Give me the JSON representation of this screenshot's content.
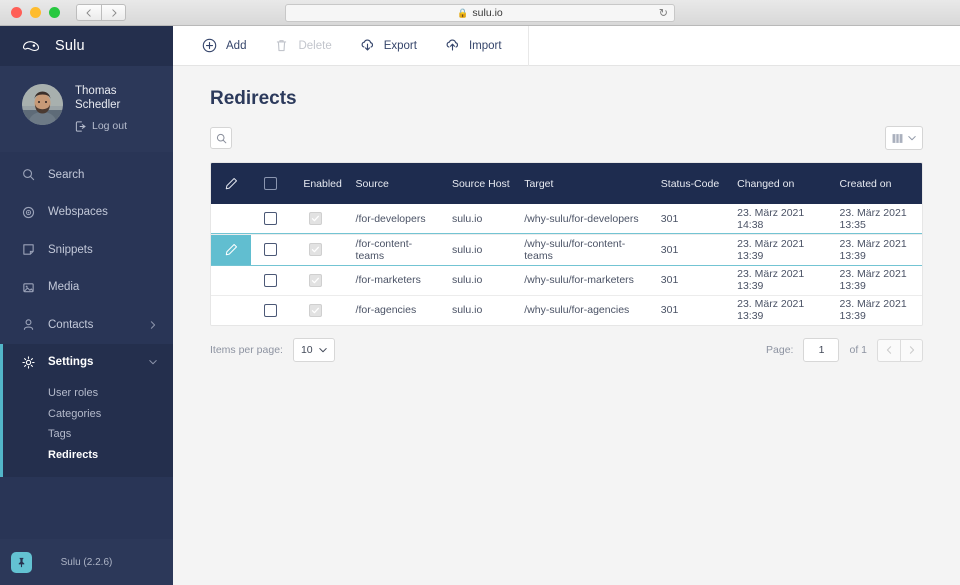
{
  "browser": {
    "url": "sulu.io",
    "lock_icon": "lock-icon",
    "reload_icon": "reload-icon",
    "back_icon": "chevron-left-icon",
    "forward_icon": "chevron-right-icon"
  },
  "sidebar": {
    "brand": {
      "name": "Sulu",
      "logo_icon": "sulu-logo-icon"
    },
    "user": {
      "name_line1": "Thomas",
      "name_line2": "Schedler",
      "logout_label": "Log out",
      "logout_icon": "logout-icon",
      "avatar_icon": "user-avatar-photo"
    },
    "items": [
      {
        "label": "Search",
        "icon": "search-icon",
        "chevron": "",
        "active": false
      },
      {
        "label": "Webspaces",
        "icon": "globe-icon",
        "chevron": "",
        "active": false
      },
      {
        "label": "Snippets",
        "icon": "snippet-icon",
        "chevron": "",
        "active": false
      },
      {
        "label": "Media",
        "icon": "media-icon",
        "chevron": "",
        "active": false
      },
      {
        "label": "Contacts",
        "icon": "contacts-icon",
        "chevron": "chevron-right-icon",
        "active": false
      },
      {
        "label": "Settings",
        "icon": "gear-icon",
        "chevron": "chevron-down-icon",
        "active": true
      }
    ],
    "subitems": [
      {
        "label": "User roles",
        "active": false
      },
      {
        "label": "Categories",
        "active": false
      },
      {
        "label": "Tags",
        "active": false
      },
      {
        "label": "Redirects",
        "active": true
      }
    ],
    "footer": {
      "version": "Sulu (2.2.6)",
      "pin_icon": "pin-icon"
    }
  },
  "toolbar": {
    "add_label": "Add",
    "add_icon": "plus-circle-icon",
    "delete_label": "Delete",
    "delete_icon": "trash-icon",
    "export_label": "Export",
    "export_icon": "cloud-download-icon",
    "import_label": "Import",
    "import_icon": "cloud-upload-icon"
  },
  "main": {
    "title": "Redirects",
    "search_icon": "search-icon",
    "view_toggle": {
      "grid_icon": "table-view-icon",
      "chevron": "chevron-down-icon"
    }
  },
  "table": {
    "header_edit_icon": "pencil-icon",
    "columns": [
      "Enabled",
      "Source",
      "Source Host",
      "Target",
      "Status-Code",
      "Changed on",
      "Created on"
    ],
    "rows": [
      {
        "enabled": true,
        "source": "/for-developers",
        "source_host": "sulu.io",
        "target": "/why-sulu/for-developers",
        "status_code": "301",
        "changed_on": "23. März 2021 14:38",
        "created_on": "23. März 2021 13:35",
        "hovered": false
      },
      {
        "enabled": true,
        "source": "/for-content-teams",
        "source_host": "sulu.io",
        "target": "/why-sulu/for-content-teams",
        "status_code": "301",
        "changed_on": "23. März 2021 13:39",
        "created_on": "23. März 2021 13:39",
        "hovered": true
      },
      {
        "enabled": true,
        "source": "/for-marketers",
        "source_host": "sulu.io",
        "target": "/why-sulu/for-marketers",
        "status_code": "301",
        "changed_on": "23. März 2021 13:39",
        "created_on": "23. März 2021 13:39",
        "hovered": false
      },
      {
        "enabled": true,
        "source": "/for-agencies",
        "source_host": "sulu.io",
        "target": "/why-sulu/for-agencies",
        "status_code": "301",
        "changed_on": "23. März 2021 13:39",
        "created_on": "23. März 2021 13:39",
        "hovered": false
      }
    ]
  },
  "pagination": {
    "items_per_page_label": "Items per page:",
    "items_per_page_value": "10",
    "page_label": "Page:",
    "page_value": "1",
    "of_label": "of 1",
    "prev_icon": "chevron-left-icon",
    "next_icon": "chevron-right-icon"
  },
  "colors": {
    "sidebar_bg": "#293556",
    "sidebar_dark": "#242f4d",
    "accent_teal": "#61bed0",
    "table_header": "#1e2c4f",
    "main_bg": "#f4f4f4"
  }
}
